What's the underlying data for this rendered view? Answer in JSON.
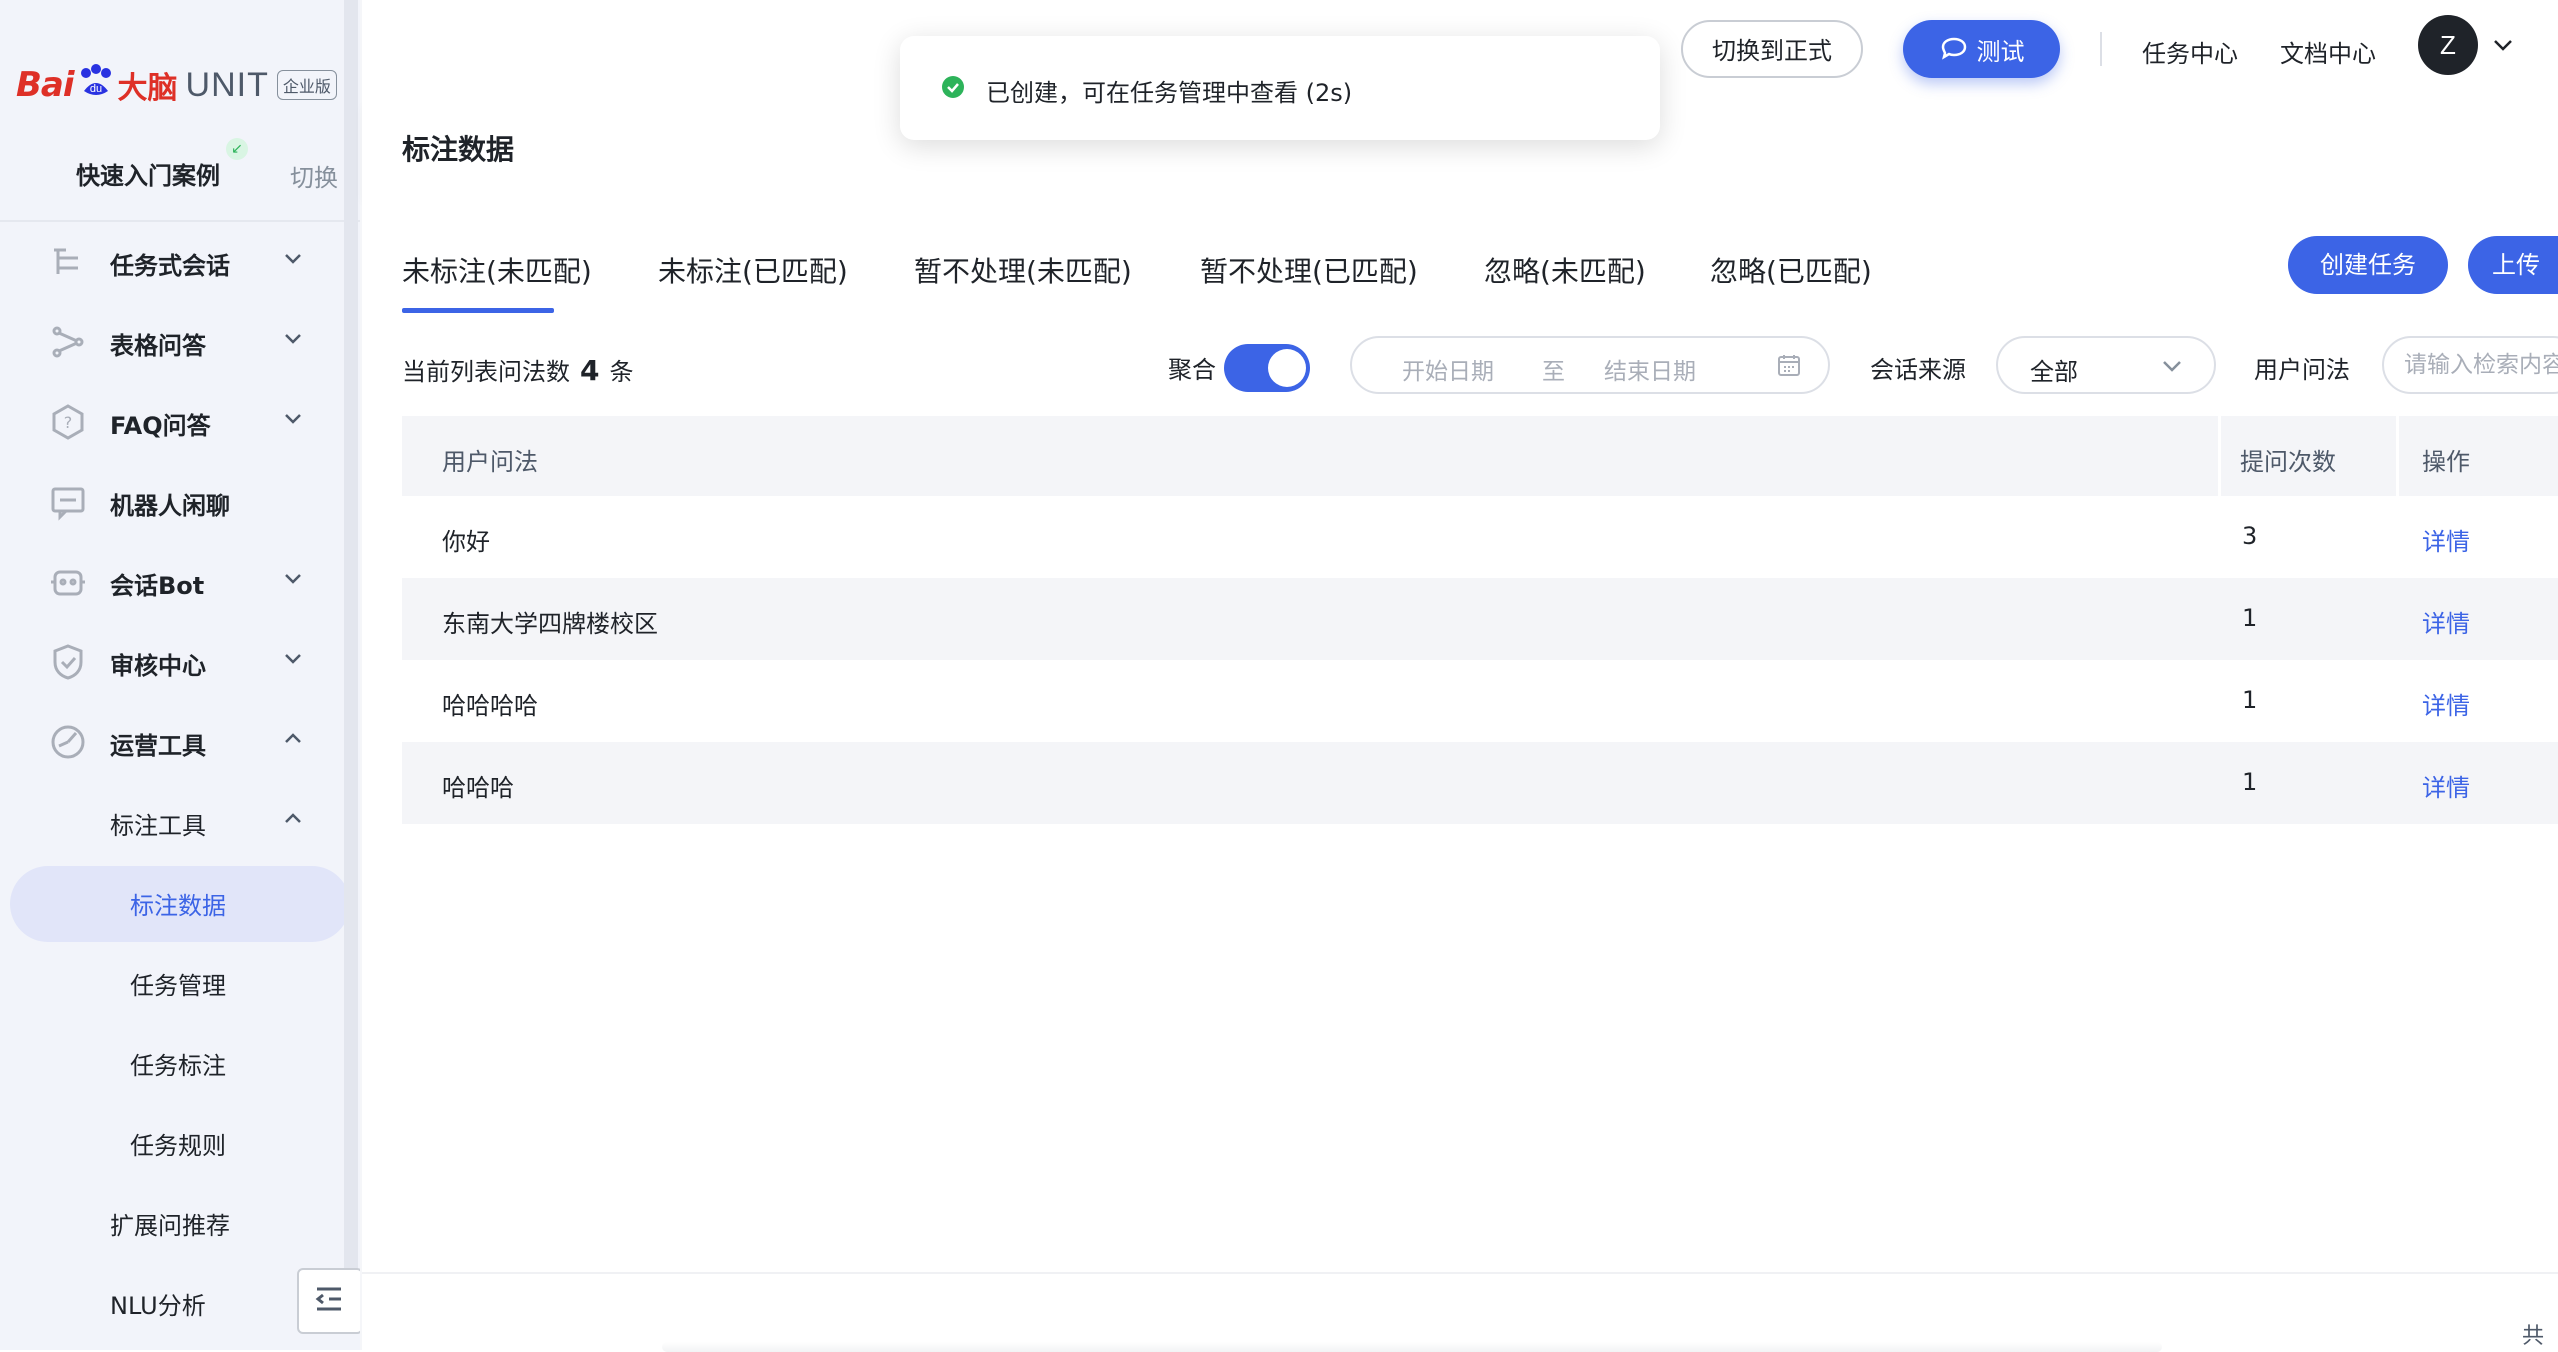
{
  "brand": {
    "bai": "Bai",
    "du": "du",
    "naonao": "大脑",
    "unit": "UNIT",
    "edition": "企业版"
  },
  "sidebar": {
    "quick_start": "快速入门案例",
    "switch_label": "切换",
    "items": [
      {
        "label": "任务式会话",
        "icon": "task-dialog-icon"
      },
      {
        "label": "表格问答",
        "icon": "table-qa-icon"
      },
      {
        "label": "FAQ问答",
        "icon": "faq-icon"
      },
      {
        "label": "机器人闲聊",
        "icon": "chat-icon"
      },
      {
        "label": "会话Bot",
        "icon": "bot-icon"
      },
      {
        "label": "审核中心",
        "icon": "shield-icon"
      },
      {
        "label": "运营工具",
        "icon": "ops-icon"
      }
    ],
    "sub_group": "标注工具",
    "sub_items": [
      "标注数据",
      "任务管理",
      "任务标注",
      "任务规则"
    ],
    "more_items": [
      "扩展问推荐",
      "NLU分析"
    ]
  },
  "topbar": {
    "switch_prod": "切换到正式",
    "test": "测试",
    "nav": [
      "任务中心",
      "文档中心"
    ],
    "avatar": "Z"
  },
  "toast": {
    "message": "已创建，可在任务管理中查看 (2s)",
    "status_color": "#2db35a"
  },
  "header": {
    "title": "标注数据"
  },
  "tabs": [
    {
      "label": "未标注(未匹配)",
      "active": true
    },
    {
      "label": "未标注(已匹配)"
    },
    {
      "label": "暂不处理(未匹配)"
    },
    {
      "label": "暂不处理(已匹配)"
    },
    {
      "label": "忽略(未匹配)"
    },
    {
      "label": "忽略(已匹配)"
    }
  ],
  "actions": {
    "create_task": "创建任务",
    "upload": "上传"
  },
  "filters": {
    "count_prefix": "当前列表问法数",
    "count": "4",
    "count_suffix": "条",
    "aggregate_label": "聚合",
    "aggregate_on": true,
    "date_start": "开始日期",
    "date_sep": "至",
    "date_end": "结束日期",
    "source_label": "会话来源",
    "source_value": "全部",
    "query_label": "用户问法",
    "query_placeholder": "请输入检索内容"
  },
  "table": {
    "columns": [
      "用户问法",
      "提问次数",
      "操作"
    ],
    "rows": [
      {
        "query": "你好",
        "count": "3",
        "action": "详情"
      },
      {
        "query": "东南大学四牌楼校区",
        "count": "1",
        "action": "详情"
      },
      {
        "query": "哈哈哈哈",
        "count": "1",
        "action": "详情"
      },
      {
        "query": "哈哈哈",
        "count": "1",
        "action": "详情"
      }
    ]
  },
  "footer": {
    "total_prefix": "共"
  },
  "colors": {
    "primary": "#3c64e6",
    "brand_red": "#de3027",
    "brand_blue": "#2932e1",
    "sidebar_bg": "#f2f4fa"
  }
}
